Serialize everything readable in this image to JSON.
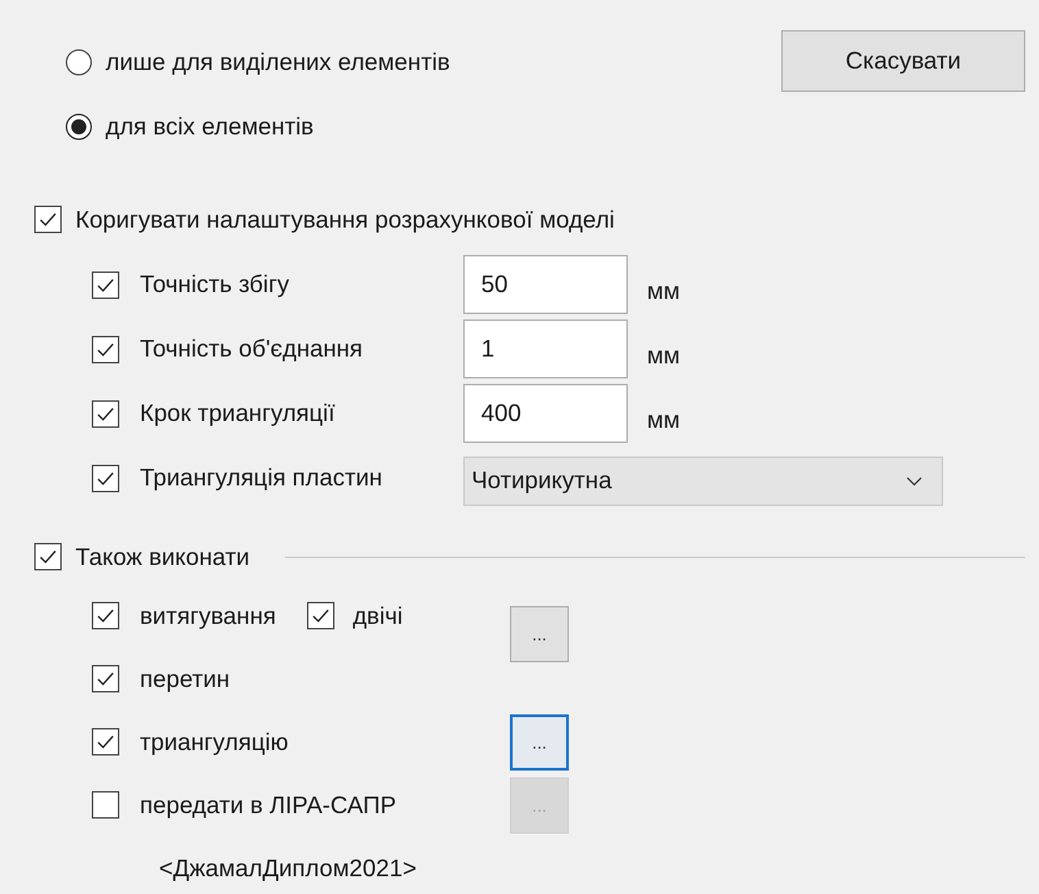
{
  "scope_options": [
    {
      "label": "лише для виділених елементів",
      "selected": false
    },
    {
      "label": "для всіх елементів",
      "selected": true
    }
  ],
  "cancel_button": "Скасувати",
  "adjust_model": {
    "label": "Коригувати налаштування розрахункової моделі",
    "checked": true,
    "fields": [
      {
        "label": "Точність збігу",
        "checked": true,
        "value": "50",
        "unit": "мм"
      },
      {
        "label": "Точність об'єднання",
        "checked": true,
        "value": "1",
        "unit": "мм"
      },
      {
        "label": "Крок триангуляції",
        "checked": true,
        "value": "400",
        "unit": "мм"
      }
    ],
    "plate_triangulation": {
      "label": "Триангуляція пластин",
      "checked": true,
      "value": "Чотирикутна"
    }
  },
  "also_execute": {
    "label": "Також виконати",
    "checked": true,
    "items": [
      {
        "label": "витягування",
        "checked": true,
        "extra": {
          "label": "двічі",
          "checked": true
        },
        "button": {
          "label": "...",
          "focused": false,
          "disabled": false
        }
      },
      {
        "label": "перетин",
        "checked": true
      },
      {
        "label": "триангуляцію",
        "checked": true,
        "button": {
          "label": "...",
          "focused": true,
          "disabled": false
        }
      },
      {
        "label": "передати в ЛІРА-САПР",
        "checked": false,
        "button": {
          "label": "...",
          "focused": false,
          "disabled": true
        }
      }
    ]
  },
  "model_name": "<ДжамалДиплом2021>"
}
